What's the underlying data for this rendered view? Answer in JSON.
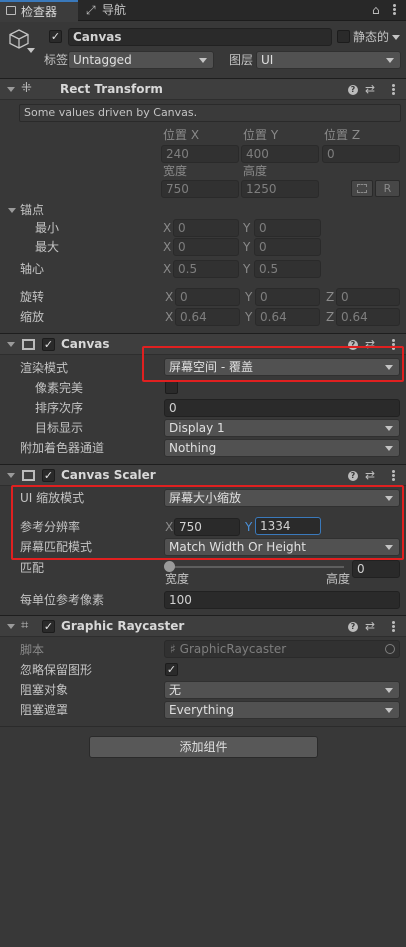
{
  "tabs": {
    "inspector": "检查器",
    "navigation": "导航"
  },
  "object": {
    "name": "Canvas",
    "static_label": "静态的",
    "tag_label": "标签",
    "tag_value": "Untagged",
    "layer_label": "图层",
    "layer_value": "UI"
  },
  "rect_transform": {
    "title": "Rect Transform",
    "info": "Some values driven by Canvas.",
    "pos_x_label": "位置 X",
    "pos_y_label": "位置 Y",
    "pos_z_label": "位置 Z",
    "pos_x": "240",
    "pos_y": "400",
    "pos_z": "0",
    "width_label": "宽度",
    "height_label": "高度",
    "width": "750",
    "height": "1250",
    "r_button": "R",
    "anchors_label": "锚点",
    "min_label": "最小",
    "max_label": "最大",
    "min_x": "0",
    "min_y": "0",
    "max_x": "0",
    "max_y": "0",
    "pivot_label": "轴心",
    "pivot_x": "0.5",
    "pivot_y": "0.5",
    "rotation_label": "旋转",
    "rot_x": "0",
    "rot_y": "0",
    "rot_z": "0",
    "scale_label": "缩放",
    "scale_x": "0.64",
    "scale_y": "0.64",
    "scale_z": "0.64"
  },
  "canvas": {
    "title": "Canvas",
    "render_mode_label": "渲染模式",
    "render_mode": "屏幕空间 - 覆盖",
    "pixel_perfect_label": "像素完美",
    "sort_order_label": "排序次序",
    "sort_order": "0",
    "target_display_label": "目标显示",
    "target_display": "Display 1",
    "shader_channels_label": "附加着色器通道",
    "shader_channels": "Nothing"
  },
  "canvas_scaler": {
    "title": "Canvas Scaler",
    "ui_scale_mode_label": "UI 缩放模式",
    "ui_scale_mode": "屏幕大小缩放",
    "ref_resolution_label": "参考分辨率",
    "ref_x": "750",
    "ref_y": "1334",
    "screen_match_label": "屏幕匹配模式",
    "screen_match": "Match Width Or Height",
    "match_label": "匹配",
    "match_value": "0",
    "width_text": "宽度",
    "height_text": "高度",
    "ref_ppu_label": "每单位参考像素",
    "ref_ppu": "100"
  },
  "graphic_raycaster": {
    "title": "Graphic Raycaster",
    "script_label": "脚本",
    "script_value": "GraphicRaycaster",
    "ignore_reversed_label": "忽略保留图形",
    "blocking_objects_label": "阻塞对象",
    "blocking_objects": "无",
    "blocking_mask_label": "阻塞遮罩",
    "blocking_mask": "Everything"
  },
  "add_component": "添加组件",
  "axis": {
    "x": "X",
    "y": "Y",
    "z": "Z"
  },
  "colors": {
    "highlight": "#e02020",
    "panel": "#383838",
    "header": "#3e3e3e"
  }
}
